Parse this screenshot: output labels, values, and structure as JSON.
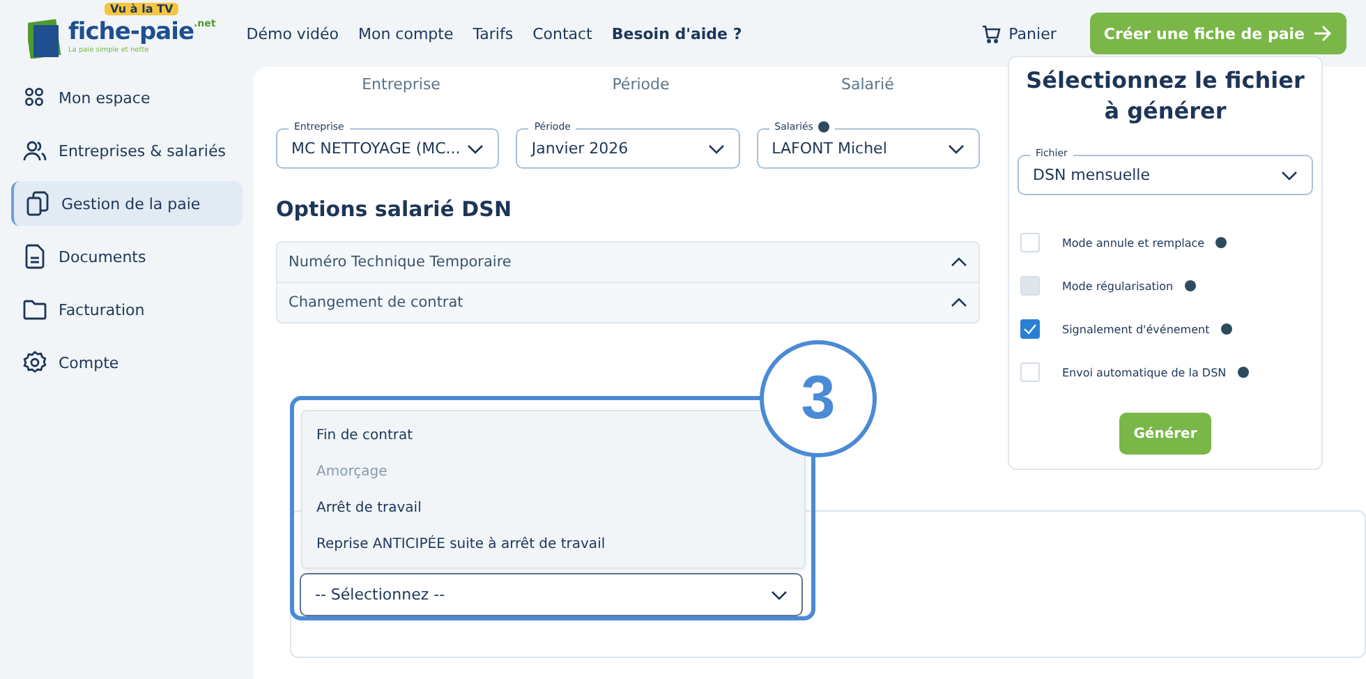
{
  "header": {
    "logo": {
      "name": "fiche-paie",
      "suffix": ".net",
      "tagline": "La paie simple et nette",
      "badge": "Vu à la TV"
    },
    "nav": [
      {
        "label": "Démo vidéo",
        "bold": false
      },
      {
        "label": "Mon compte",
        "bold": false
      },
      {
        "label": "Tarifs",
        "bold": false
      },
      {
        "label": "Contact",
        "bold": false
      },
      {
        "label": "Besoin d'aide ?",
        "bold": true
      }
    ],
    "cart": "Panier",
    "cta": "Créer une fiche de paie"
  },
  "sidebar": {
    "items": [
      {
        "label": "Mon espace",
        "selected": false
      },
      {
        "label": "Entreprises & salariés",
        "selected": false
      },
      {
        "label": "Gestion de la paie",
        "selected": true
      },
      {
        "label": "Documents",
        "selected": false
      },
      {
        "label": "Facturation",
        "selected": false
      },
      {
        "label": "Compte",
        "selected": false
      }
    ]
  },
  "steps": [
    "Entreprise",
    "Période",
    "Salarié"
  ],
  "selects": [
    {
      "label": "Entreprise",
      "value": "MC NETTOYAGE (MC...",
      "help": false
    },
    {
      "label": "Période",
      "value": "Janvier 2026",
      "help": false
    },
    {
      "label": "Salariés",
      "value": "LAFONT Michel",
      "help": true
    }
  ],
  "options_title": "Options salarié DSN",
  "accordion": [
    {
      "label": "Numéro Technique Temporaire",
      "expanded": true
    },
    {
      "label": "Changement de contrat",
      "expanded": true
    }
  ],
  "event_select": {
    "placeholder": "-- Sélectionnez --"
  },
  "event_menu": [
    {
      "label": "Fin de contrat",
      "disabled": false
    },
    {
      "label": "Amorçage",
      "disabled": true
    },
    {
      "label": "Arrêt de travail",
      "disabled": false
    },
    {
      "label": "Reprise ANTICIPÉE suite à arrêt de travail",
      "disabled": false
    }
  ],
  "annotation": "3",
  "panel": {
    "title": "Sélectionnez le fichier à générer",
    "file_label": "Fichier",
    "file_value": "DSN mensuelle",
    "options": [
      {
        "label": "Mode annule et remplace",
        "checked": false,
        "disabled": false
      },
      {
        "label": "Mode régularisation",
        "checked": false,
        "disabled": true
      },
      {
        "label": "Signalement d'événement",
        "checked": true,
        "disabled": false
      },
      {
        "label": "Envoi automatique de la DSN",
        "checked": false,
        "disabled": false
      }
    ],
    "button": "Générer"
  }
}
